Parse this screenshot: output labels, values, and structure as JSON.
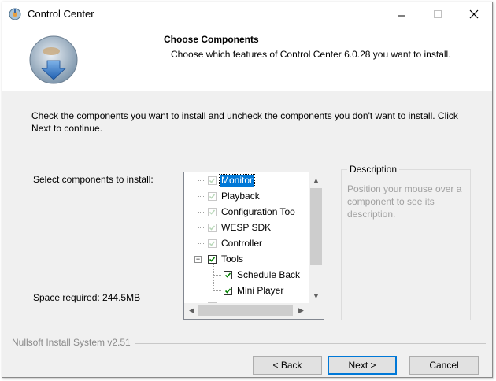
{
  "window": {
    "title": "Control Center"
  },
  "header": {
    "title": "Choose Components",
    "subtitle": "Choose which features of Control Center 6.0.28 you want to install."
  },
  "intro": "Check the components you want to install and uncheck the components you don't want to install. Click Next to continue.",
  "select_label": "Select components to install:",
  "space_required": "Space required: 244.5MB",
  "components": [
    {
      "label": "Monitor",
      "checked": true,
      "disabled": true,
      "selected": true
    },
    {
      "label": "Playback",
      "checked": true,
      "disabled": true
    },
    {
      "label": "Configuration Too",
      "checked": true,
      "disabled": true
    },
    {
      "label": "WESP SDK",
      "checked": true,
      "disabled": true
    },
    {
      "label": "Controller",
      "checked": true,
      "disabled": true
    },
    {
      "label": "Tools",
      "checked": true,
      "expanded": true
    },
    {
      "label": "Schedule Back",
      "checked": true
    },
    {
      "label": "Mini Player",
      "checked": true
    }
  ],
  "description": {
    "title": "Description",
    "text": "Position your mouse over a component to see its description."
  },
  "footer": {
    "brand": "Nullsoft Install System v2.51"
  },
  "buttons": {
    "back": "< Back",
    "next": "Next >",
    "cancel": "Cancel"
  },
  "colors": {
    "accent": "#0078d7",
    "check": "#008000",
    "disabled_check": "#b8d8b8"
  },
  "icons": {
    "app": "control-center-app-icon",
    "header": "installer-disc-icon",
    "minimize": "minimize-icon",
    "maximize": "maximize-icon",
    "close": "close-icon"
  }
}
